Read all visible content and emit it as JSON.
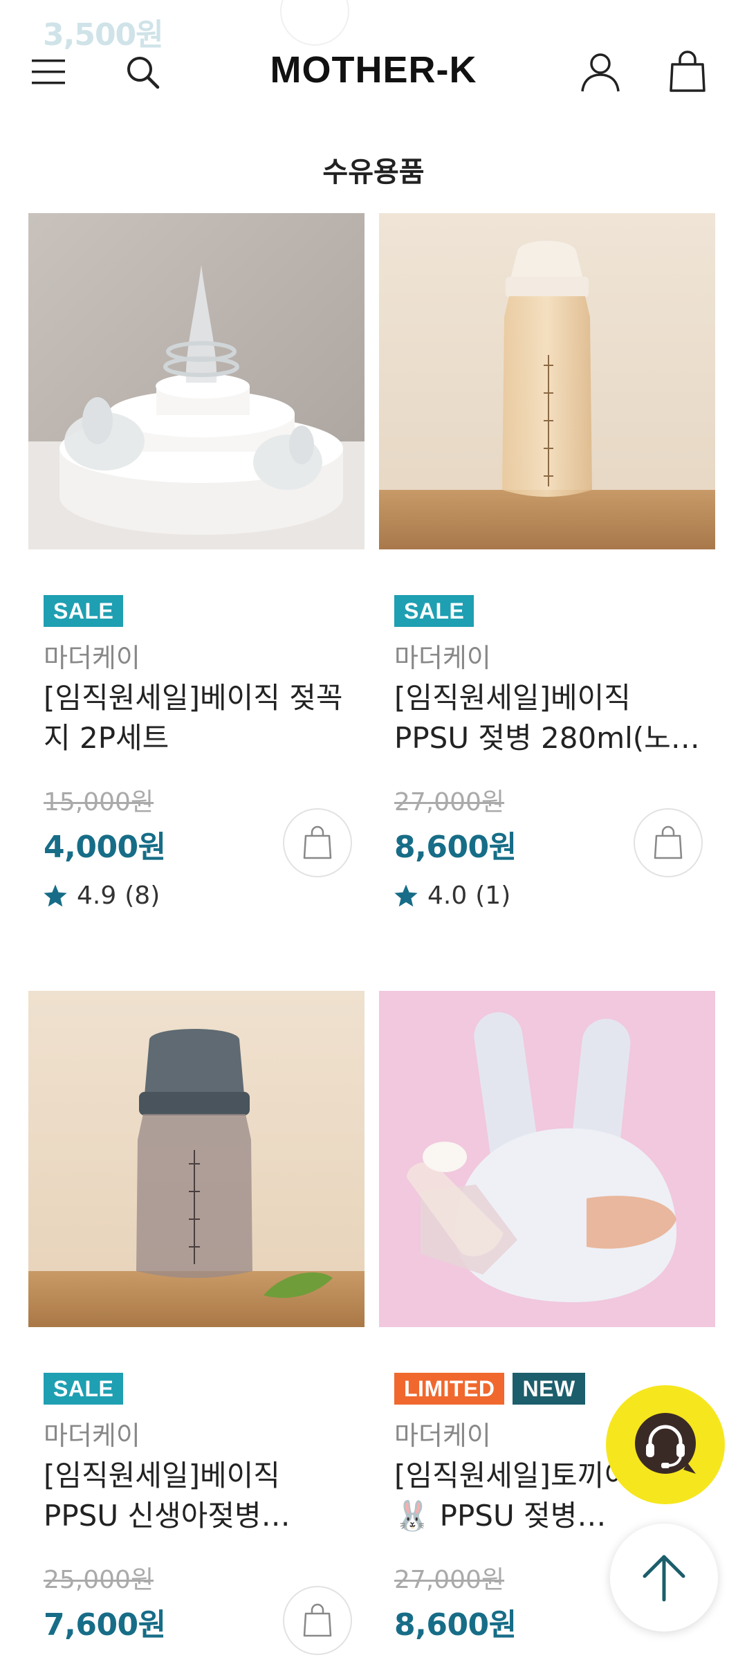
{
  "ghost": {
    "price": "3,500원"
  },
  "header": {
    "logo": "MOTHER-K",
    "icons": [
      "menu-icon",
      "search-icon",
      "user-icon",
      "shopping-bag-icon"
    ]
  },
  "section": {
    "title": "수유용품"
  },
  "products": [
    {
      "badges": [
        {
          "label": "SALE",
          "color": "#1f9fb2"
        }
      ],
      "brand": "마더케이",
      "name_line1": "[임직원세일]베이직 젖꼭",
      "name_line2": "지 2P세트",
      "original_price": "15,000원",
      "price": "4,000원",
      "rating": "4.9",
      "reviews": "(8)"
    },
    {
      "badges": [
        {
          "label": "SALE",
          "color": "#1f9fb2"
        }
      ],
      "brand": "마더케이",
      "name_line1": "[임직원세일]베이직",
      "name_line2": "PPSU 젖병 280ml(노…",
      "original_price": "27,000원",
      "price": "8,600원",
      "rating": "4.0",
      "reviews": "(1)"
    },
    {
      "badges": [
        {
          "label": "SALE",
          "color": "#1f9fb2"
        }
      ],
      "brand": "마더케이",
      "name_line1": "[임직원세일]베이직",
      "name_line2": "PPSU 신생아젖병…",
      "original_price": "25,000원",
      "price": "7,600원"
    },
    {
      "badges": [
        {
          "label": "LIMITED",
          "color": "#f0682e"
        },
        {
          "label": "NEW",
          "color": "#1c5e6b"
        }
      ],
      "brand": "마더케이",
      "name_line1": "[임직원세일]토끼이",
      "name_line2": "🐰 PPSU 젖병…",
      "original_price": "27,000원",
      "price": "8,600원"
    }
  ],
  "fabs": {
    "chat": "headset-chat-icon",
    "top": "arrow-up-icon"
  },
  "colors": {
    "accent": "#176d87",
    "sale_badge": "#1f9fb2",
    "star": "#176d87",
    "chat_fab": "#f6e61e"
  }
}
